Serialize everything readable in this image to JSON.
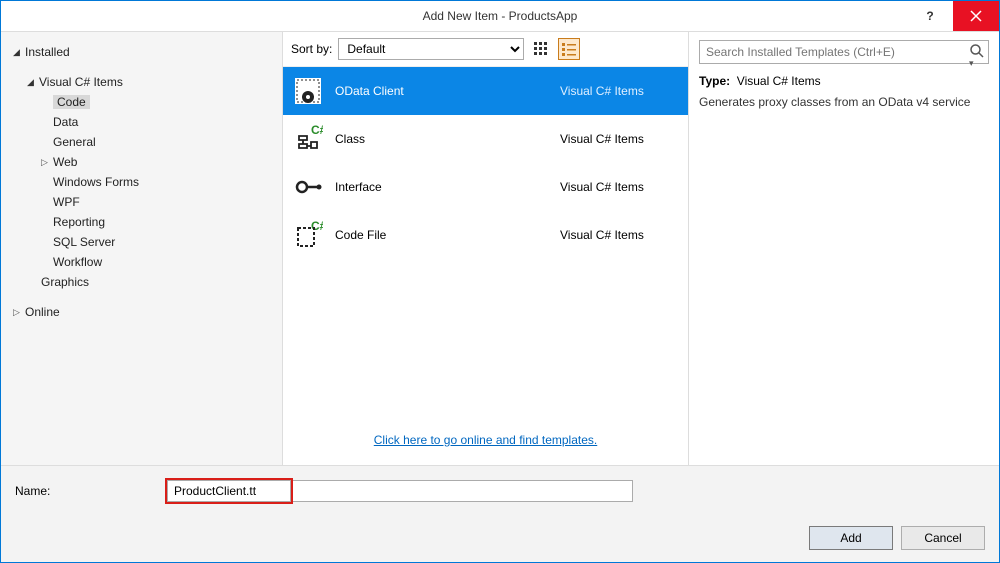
{
  "title": "Add New Item - ProductsApp",
  "tree": {
    "installed": "Installed",
    "csharp_items": "Visual C# Items",
    "code": "Code",
    "data": "Data",
    "general": "General",
    "web": "Web",
    "winforms": "Windows Forms",
    "wpf": "WPF",
    "reporting": "Reporting",
    "sqlserver": "SQL Server",
    "workflow": "Workflow",
    "graphics": "Graphics",
    "online": "Online"
  },
  "sort": {
    "label": "Sort by:",
    "value": "Default"
  },
  "templates": [
    {
      "name": "OData Client",
      "category": "Visual C# Items"
    },
    {
      "name": "Class",
      "category": "Visual C# Items"
    },
    {
      "name": "Interface",
      "category": "Visual C# Items"
    },
    {
      "name": "Code File",
      "category": "Visual C# Items"
    }
  ],
  "online_link": "Click here to go online and find templates.",
  "search": {
    "placeholder": "Search Installed Templates (Ctrl+E)"
  },
  "detail": {
    "type_label": "Type:",
    "type_value": "Visual C# Items",
    "description": "Generates proxy classes from an OData v4 service"
  },
  "name_field": {
    "label": "Name:",
    "value": "ProductClient.tt"
  },
  "buttons": {
    "add": "Add",
    "cancel": "Cancel"
  }
}
